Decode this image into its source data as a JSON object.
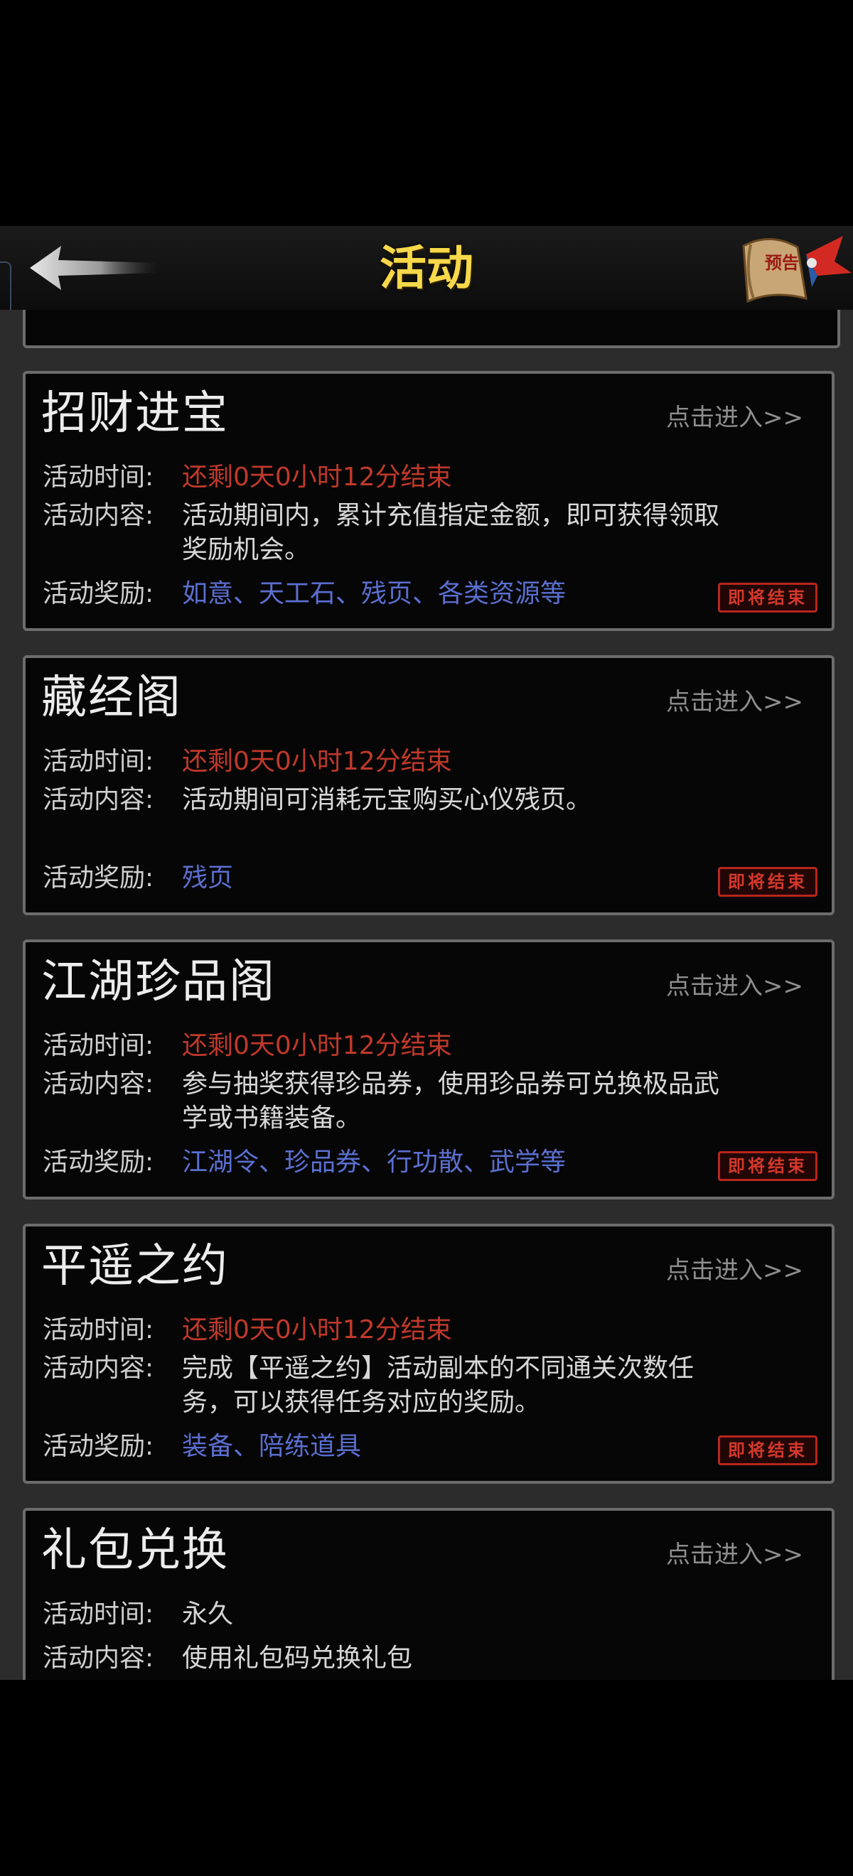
{
  "header": {
    "title": "活动",
    "notice_icon_text": "预告"
  },
  "cards": [
    {
      "title": "招财进宝",
      "enter": "点击进入>>",
      "time_label": "活动时间:",
      "time": "还剩0天0小时12分结束",
      "content_label": "活动内容:",
      "content": "活动期间内，累计充值指定金额，即可获得领取奖励机会。",
      "reward_label": "活动奖励:",
      "reward": "如意、天工石、残页、各类资源等",
      "stamp": "即将结束"
    },
    {
      "title": "藏经阁",
      "enter": "点击进入>>",
      "time_label": "活动时间:",
      "time": "还剩0天0小时12分结束",
      "content_label": "活动内容:",
      "content": "活动期间可消耗元宝购买心仪残页。",
      "reward_label": "活动奖励:",
      "reward": "残页",
      "stamp": "即将结束"
    },
    {
      "title": "江湖珍品阁",
      "enter": "点击进入>>",
      "time_label": "活动时间:",
      "time": "还剩0天0小时12分结束",
      "content_label": "活动内容:",
      "content": "参与抽奖获得珍品券，使用珍品券可兑换极品武学或书籍装备。",
      "reward_label": "活动奖励:",
      "reward": "江湖令、珍品券、行功散、武学等",
      "stamp": "即将结束"
    },
    {
      "title": "平遥之约",
      "enter": "点击进入>>",
      "time_label": "活动时间:",
      "time": "还剩0天0小时12分结束",
      "content_label": "活动内容:",
      "content": "完成【平遥之约】活动副本的不同通关次数任务，可以获得任务对应的奖励。",
      "reward_label": "活动奖励:",
      "reward": "装备、陪练道具",
      "stamp": "即将结束"
    },
    {
      "title": "礼包兑换",
      "enter": "点击进入>>",
      "time_label": "活动时间:",
      "time": "永久",
      "content_label": "活动内容:",
      "content": "使用礼包码兑换礼包"
    }
  ],
  "colors": {
    "title_gold": "#f6d84a",
    "time_red": "#c0392b",
    "reward_blue": "#5b6fd0",
    "card_border": "#6c6c6c"
  }
}
